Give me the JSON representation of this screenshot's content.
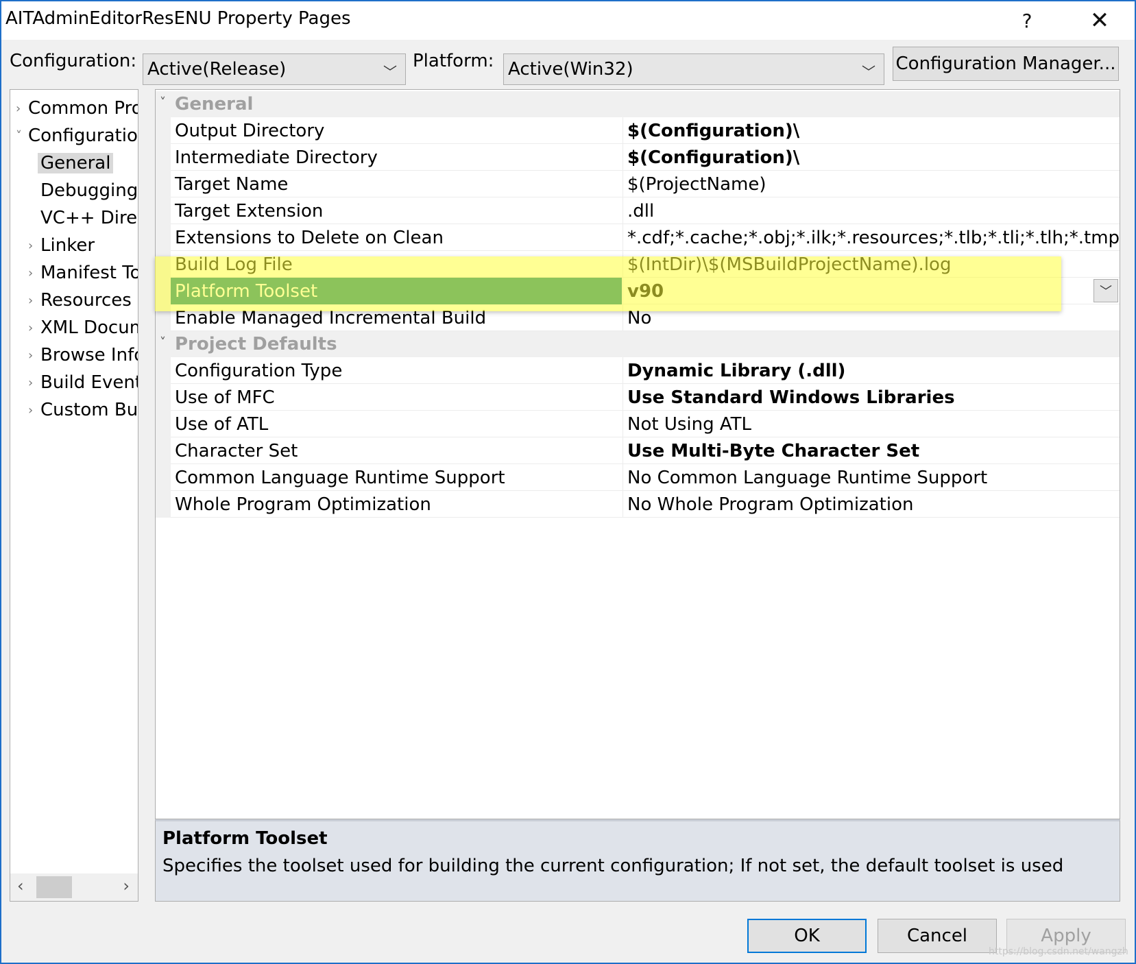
{
  "window": {
    "title": "AITAdminEditorResENU Property Pages",
    "help": "?",
    "close": "✕"
  },
  "toolbar": {
    "configuration_label": "Configuration:",
    "configuration_value": "Active(Release)",
    "platform_label": "Platform:",
    "platform_value": "Active(Win32)",
    "config_manager_label": "Configuration Manager..."
  },
  "tree": {
    "items": [
      {
        "label": "Common Pro",
        "arrow": "›"
      },
      {
        "label": "Configuratior",
        "arrow": "˅"
      },
      {
        "label": "General",
        "arrow": ""
      },
      {
        "label": "Debugging",
        "arrow": ""
      },
      {
        "label": "VC++ Direc",
        "arrow": ""
      },
      {
        "label": "Linker",
        "arrow": "›"
      },
      {
        "label": "Manifest To",
        "arrow": "›"
      },
      {
        "label": "Resources",
        "arrow": "›"
      },
      {
        "label": "XML Docum",
        "arrow": "›"
      },
      {
        "label": "Browse Info",
        "arrow": "›"
      },
      {
        "label": "Build Events",
        "arrow": "›"
      },
      {
        "label": "Custom Buil",
        "arrow": "›"
      }
    ],
    "scroll_left": "‹",
    "scroll_right": "›"
  },
  "grid": {
    "general": {
      "title": "General",
      "rows": [
        {
          "name": "Output Directory",
          "value": "$(Configuration)\\"
        },
        {
          "name": "Intermediate Directory",
          "value": "$(Configuration)\\"
        },
        {
          "name": "Target Name",
          "value": "$(ProjectName)"
        },
        {
          "name": "Target Extension",
          "value": ".dll"
        },
        {
          "name": "Extensions to Delete on Clean",
          "value": "*.cdf;*.cache;*.obj;*.ilk;*.resources;*.tlb;*.tli;*.tlh;*.tmp;*.rsp;*.pgc;*.pgd;*.meta;*.tlog;*.manifest;*.res;*.pch;*.exp;*.idb;*.rep;*.xdc;*.pdb;*_manifest.rc;*.bsc;*.sbr;*.xml;*.metagen;*.bi"
        },
        {
          "name": "Build Log File",
          "value": "$(IntDir)\\$(MSBuildProjectName).log"
        },
        {
          "name": "Platform Toolset",
          "value": "v90"
        },
        {
          "name": "Enable Managed Incremental Build",
          "value": "No"
        }
      ]
    },
    "project_defaults": {
      "title": "Project Defaults",
      "rows": [
        {
          "name": "Configuration Type",
          "value": "Dynamic Library (.dll)"
        },
        {
          "name": "Use of MFC",
          "value": "Use Standard Windows Libraries"
        },
        {
          "name": "Use of ATL",
          "value": "Not Using ATL"
        },
        {
          "name": "Character Set",
          "value": "Use Multi-Byte Character Set"
        },
        {
          "name": "Common Language Runtime Support",
          "value": "No Common Language Runtime Support"
        },
        {
          "name": "Whole Program Optimization",
          "value": "No Whole Program Optimization"
        }
      ]
    }
  },
  "description": {
    "title": "Platform Toolset",
    "text": "Specifies the toolset used for building the current configuration; If not set, the default toolset is used"
  },
  "buttons": {
    "ok": "OK",
    "cancel": "Cancel",
    "apply": "Apply"
  },
  "watermark": "https://blog.csdn.net/wangzh",
  "colors": {
    "selected_row": "#007a80",
    "highlight": "#ffff3c",
    "window_border": "#1e6fc9"
  }
}
